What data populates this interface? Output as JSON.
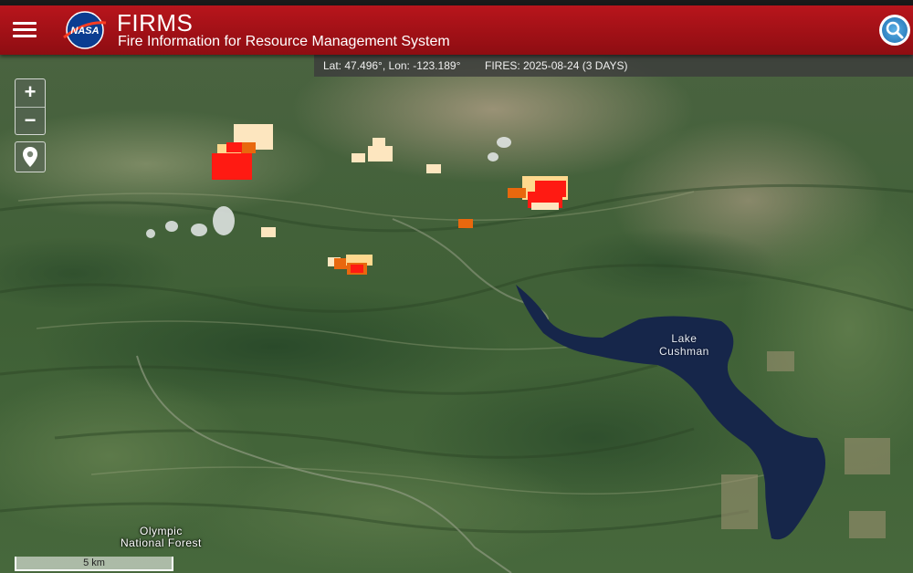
{
  "header": {
    "logo_text": "NASA",
    "title": "FIRMS",
    "subtitle": "Fire Information for Resource Management System"
  },
  "infobar": {
    "coords": "Lat: 47.496°, Lon: -123.189°",
    "fires": "FIRES: 2025-08-24 (3 DAYS)"
  },
  "controls": {
    "zoom_in": "+",
    "zoom_out": "−"
  },
  "map_labels": {
    "lake": [
      "Lake",
      "Cushman"
    ],
    "forest": [
      "Olympic",
      "National Forest"
    ]
  },
  "scale_bar": "5 km",
  "icons": [
    "menu-icon",
    "nasa-logo",
    "search-icon",
    "location-pin-icon"
  ],
  "colors": {
    "header_red": "#a3121a",
    "fire_recent": "#ff1a12",
    "fire_day2": "#e8680e",
    "fire_day3": "#ffd98e",
    "fire_older": "#fde6bf"
  }
}
